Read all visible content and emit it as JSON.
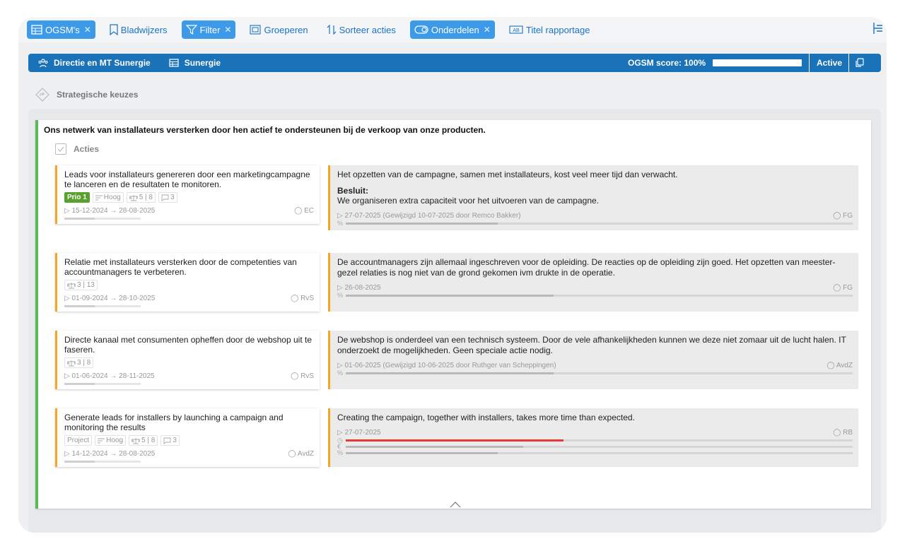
{
  "toolbar": {
    "items": [
      {
        "label": "OGSM's",
        "icon": "table-icon",
        "active": true,
        "closable": true
      },
      {
        "label": "Bladwijzers",
        "icon": "bookmark-icon",
        "active": false,
        "closable": false
      },
      {
        "label": "Filter",
        "icon": "filter-icon",
        "active": true,
        "closable": true
      },
      {
        "label": "Groeperen",
        "icon": "group-icon",
        "active": false,
        "closable": false
      },
      {
        "label": "Sorteer acties",
        "icon": "sort-icon",
        "active": false,
        "closable": false
      },
      {
        "label": "Onderdelen",
        "icon": "toggle-icon",
        "active": true,
        "closable": true
      },
      {
        "label": "Titel rapportage",
        "icon": "title-ab-icon",
        "active": false,
        "closable": false
      }
    ]
  },
  "header": {
    "team": "Directie en MT Sunergie",
    "org": "Sunergie",
    "score_label": "OGSM score: 100%",
    "score_fraction": 1.0,
    "status": "Active"
  },
  "section": {
    "title": "Strategische keuzes"
  },
  "goal": {
    "title": "Ons netwerk van installateurs versterken door hen actief te ondersteunen bij de verkoop van onze producten.",
    "acties_label": "Acties"
  },
  "actions": [
    {
      "title": "Leads voor installateurs genereren door een marketingcampagne te lanceren en de resultaten te monitoren.",
      "tags": [
        {
          "text": "Prio 1",
          "kind": "prio"
        },
        {
          "text": "Hoog",
          "kind": "priority"
        },
        {
          "text": "5 | 8",
          "kind": "scale"
        },
        {
          "text": "3",
          "kind": "comments"
        }
      ],
      "dates": "▷ 15-12-2024 → 28-08-2025",
      "owner": "EC",
      "progress": 0.4,
      "note": {
        "text": "Het opzetten van de campagne, samen met installateurs, kost veel meer tijd dan verwacht.",
        "besluit_label": "Besluit:",
        "besluit_text": "We organiseren extra capaciteit voor het uitvoeren van de campagne.",
        "meta": "▷ 27-07-2025 (Gewijzigd 10-07-2025 door Remco Bakker)",
        "owner": "FG",
        "bars": [
          {
            "symbol": "%",
            "value": 0.3,
            "color": "gray"
          }
        ]
      }
    },
    {
      "title": "Relatie met installateurs versterken door de competenties van accountmanagers te verbeteren.",
      "tags": [
        {
          "text": "3 | 13",
          "kind": "scale"
        }
      ],
      "dates": "▷ 01-09-2024 → 28-10-2025",
      "owner": "RvS",
      "progress": 0.4,
      "note": {
        "text": "De accountmanagers zijn allemaal ingeschreven voor de opleiding. De reacties op de opleiding zijn goed. Het opzetten van meester-gezel relaties is nog niet van de grond gekomen ivm drukte in de operatie.",
        "besluit_label": "",
        "besluit_text": "",
        "meta": "▷ 26-08-2025",
        "owner": "FG",
        "bars": [
          {
            "symbol": "%",
            "value": 0.41,
            "color": "gray"
          }
        ]
      }
    },
    {
      "title": "Directe kanaal met consumenten opheffen door de webshop uit te faseren.",
      "tags": [
        {
          "text": "3 | 8",
          "kind": "scale"
        }
      ],
      "dates": "▷ 01-06-2024 → 28-11-2025",
      "owner": "RvS",
      "progress": 0.4,
      "note": {
        "text": "De webshop is onderdeel van een technisch systeem. Door de vele afhankelijkheden kunnen we deze niet zomaar uit de lucht halen. IT onderzoekt de mogelijkheden. Geen speciale actie nodig.",
        "besluit_label": "",
        "besluit_text": "",
        "meta": "▷ 01-06-2025 (Gewijzigd 10-06-2025 door Ruthger van Scheppingen)",
        "owner": "AvdZ",
        "bars": [
          {
            "symbol": "%",
            "value": 0.41,
            "color": "gray"
          }
        ]
      }
    },
    {
      "title": "Generate leads for installers by launching a campaign and monitoring the results",
      "tags": [
        {
          "text": "Project",
          "kind": "project"
        },
        {
          "text": "Hoog",
          "kind": "priority"
        },
        {
          "text": "5 | 8",
          "kind": "scale"
        },
        {
          "text": "3",
          "kind": "comments"
        }
      ],
      "dates": "▷ 14-12-2024 → 28-08-2025",
      "owner": "AvdZ",
      "progress": 0.4,
      "note": {
        "text": "Creating the campaign, together with installers, takes more time than expected.",
        "besluit_label": "",
        "besluit_text": "",
        "meta": "▷ 27-07-2025",
        "owner": "RB",
        "bars": [
          {
            "symbol": "◷",
            "value": 0.43,
            "color": "red"
          },
          {
            "symbol": "€",
            "value": 0.35,
            "color": "gray"
          },
          {
            "symbol": "%",
            "value": 0.3,
            "color": "gray"
          }
        ]
      }
    }
  ]
}
